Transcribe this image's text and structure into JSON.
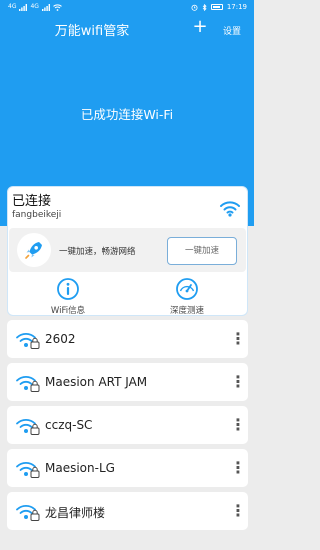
{
  "statusbar": {
    "carrier_1": "4G",
    "carrier_2": "4G",
    "time": "17:19"
  },
  "appbar": {
    "title": "万能wifi管家",
    "add_label": "+",
    "settings_label": "设置"
  },
  "hero": {
    "message": "已成功连接Wi-Fi"
  },
  "connected_card": {
    "title": "已连接",
    "ssid": "fangbeikeji",
    "boost_text": "一键加速，畅游网络",
    "boost_button": "一键加速",
    "tools": [
      {
        "label": "WiFi信息",
        "icon": "info-icon"
      },
      {
        "label": "深度测速",
        "icon": "speedometer-icon"
      }
    ]
  },
  "networks": [
    {
      "name": "2602",
      "locked": true,
      "icon_color": "#1f9df1"
    },
    {
      "name": "Maesion ART JAM",
      "locked": true,
      "icon_color": "#1f9df1"
    },
    {
      "name": "cczq-SC",
      "locked": true,
      "icon_color": "#1f9df1"
    },
    {
      "name": "Maesion-LG",
      "locked": true,
      "icon_color": "#1f9df1"
    },
    {
      "name": "龙昌律师楼",
      "locked": true,
      "icon_color": "#1f9df1"
    }
  ],
  "colors": {
    "primary": "#1f9df1",
    "background": "#ececec"
  }
}
